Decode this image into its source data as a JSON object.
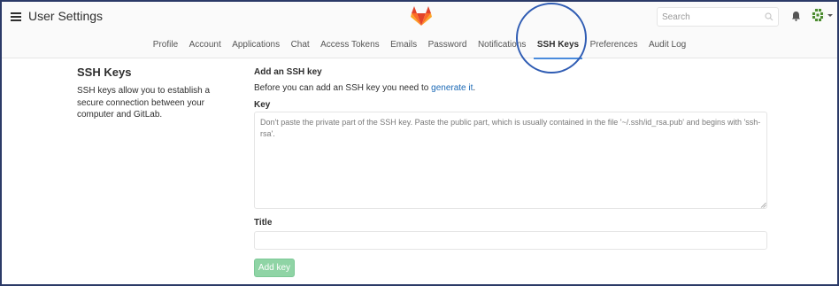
{
  "header": {
    "title": "User Settings",
    "search_placeholder": "Search"
  },
  "nav": {
    "items": [
      {
        "label": "Profile"
      },
      {
        "label": "Account"
      },
      {
        "label": "Applications"
      },
      {
        "label": "Chat"
      },
      {
        "label": "Access Tokens"
      },
      {
        "label": "Emails"
      },
      {
        "label": "Password"
      },
      {
        "label": "Notifications"
      },
      {
        "label": "SSH Keys",
        "active": true
      },
      {
        "label": "Preferences"
      },
      {
        "label": "Audit Log"
      }
    ]
  },
  "sidebar": {
    "title": "SSH Keys",
    "description": "SSH keys allow you to establish a secure connection between your computer and GitLab."
  },
  "form": {
    "add_title": "Add an SSH key",
    "help_prefix": "Before you can add an SSH key you need to ",
    "help_link": "generate it",
    "help_suffix": ".",
    "key_label": "Key",
    "key_placeholder": "Don't paste the private part of the SSH key. Paste the public part, which is usually contained in the file '~/.ssh/id_rsa.pub' and begins with 'ssh-rsa'.",
    "title_label": "Title",
    "title_value": "",
    "submit_label": "Add key"
  },
  "colors": {
    "frame_border": "#2b3a67",
    "active_tab_underline": "#4a8bdc",
    "highlight_circle": "#2f5cb3",
    "link": "#1b69b6",
    "submit_button": "#8fd4a5",
    "logo_orange": "#fc6d26",
    "logo_red": "#e24329",
    "logo_light": "#fca326"
  },
  "icons": {
    "menu": "hamburger-icon",
    "logo": "gitlab-logo",
    "search": "search-icon",
    "notifications": "bell-icon",
    "user": "avatar",
    "user_menu": "caret-down-icon"
  }
}
